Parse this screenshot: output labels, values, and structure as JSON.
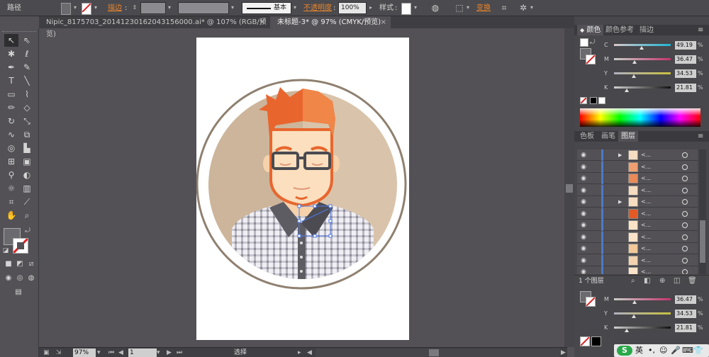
{
  "controlbar": {
    "mode_label": "路径",
    "stroke_label": "描边",
    "stroke_style_label": "基本",
    "opacity_label": "不透明度",
    "opacity_value": "100%",
    "style_label": "样式",
    "transform_label": "变换"
  },
  "tabs": [
    {
      "label": "Nipic_8175703_20141230162043156000.ai* @ 107% (RGB/预览)",
      "close": "×"
    },
    {
      "label": "未标题-3* @ 97% (CMYK/预览)",
      "close": "×"
    }
  ],
  "status": {
    "zoom": "97%",
    "page": "1",
    "mode": "选择"
  },
  "color_panel": {
    "tabs": [
      "颜色",
      "颜色参考",
      "描边"
    ],
    "sliders": [
      {
        "label": "C",
        "value": "49.19",
        "fraction": 0.49,
        "pct": "%"
      },
      {
        "label": "M",
        "value": "36.47",
        "fraction": 0.36,
        "pct": "%"
      },
      {
        "label": "Y",
        "value": "34.53",
        "fraction": 0.35,
        "pct": "%"
      },
      {
        "label": "K",
        "value": "21.81",
        "fraction": 0.22,
        "pct": "%"
      }
    ]
  },
  "layers_panel": {
    "tabs": [
      "色板",
      "画笔",
      "图层"
    ],
    "rows": [
      {
        "name": "<...",
        "expand": "▶",
        "thumb_color": "#f6dcc0"
      },
      {
        "name": "<...",
        "expand": "",
        "thumb_color": "#f0a070"
      },
      {
        "name": "<...",
        "expand": "",
        "thumb_color": "#e88a5a"
      },
      {
        "name": "<...",
        "expand": "",
        "thumb_color": "#f6dcc0"
      },
      {
        "name": "<...",
        "expand": "▶",
        "thumb_color": "#f6dcc0"
      },
      {
        "name": "<...",
        "expand": "",
        "thumb_color": "#e35a25"
      },
      {
        "name": "<...",
        "expand": "",
        "thumb_color": "#fbe3c8"
      },
      {
        "name": "<...",
        "expand": "",
        "thumb_color": "#fbe3c8"
      },
      {
        "name": "<...",
        "expand": "",
        "thumb_color": "#f2c898"
      },
      {
        "name": "<...",
        "expand": "",
        "thumb_color": "#f4d2b0"
      },
      {
        "name": "<...",
        "expand": "",
        "thumb_color": "#fbe3c8"
      },
      {
        "name": "<...",
        "expand": "",
        "thumb_color": "#f8e8d4"
      },
      {
        "name": "<...",
        "expand": "",
        "thumb_color": "#c8b49c"
      }
    ],
    "layer_count": "1 个图层"
  },
  "lower_sliders": [
    {
      "label": "M",
      "value": "36.47",
      "fraction": 0.36,
      "pct": "%"
    },
    {
      "label": "Y",
      "value": "34.53",
      "fraction": 0.35,
      "pct": "%"
    },
    {
      "label": "K",
      "value": "21.81",
      "fraction": 0.22,
      "pct": "%"
    }
  ],
  "tray": {
    "ime": "英"
  },
  "colors": {
    "accent_orange": "#e9852c",
    "hair": "#e8662e",
    "bg_circle": "#d3bea4",
    "skin": "#fbdfbe"
  }
}
